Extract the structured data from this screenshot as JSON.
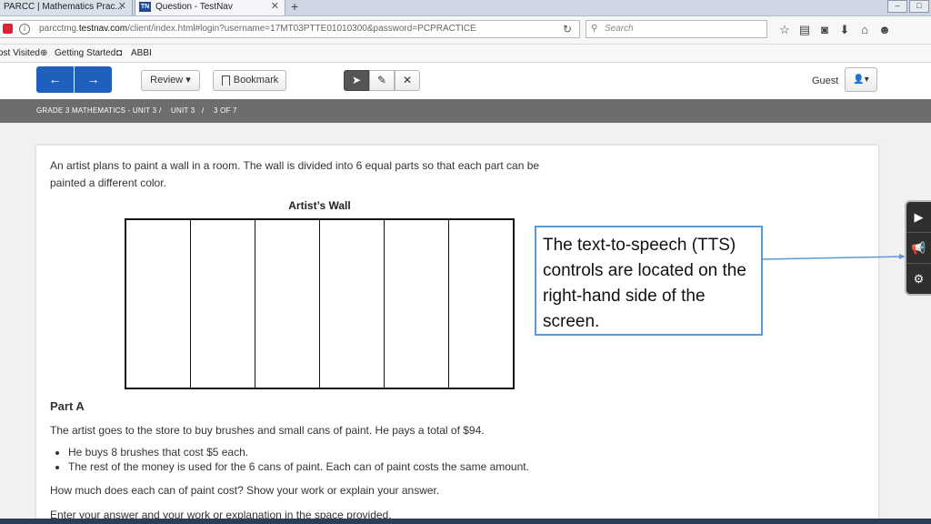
{
  "browser": {
    "tabs": [
      {
        "label": "PARCC | Mathematics Prac...",
        "close": "✕"
      },
      {
        "label": "Question - TestNav",
        "close": "✕",
        "favicon": "TN"
      }
    ],
    "new_tab": "+",
    "url": {
      "prefix": "parcctmg.",
      "domain": "testnav.com",
      "path": "/client/index.html#login?username=17MT03PTTE01010300&password=PCPRACTICE"
    },
    "search_placeholder": "Search",
    "bookmarks": [
      "ost Visited",
      "Getting Started",
      "ABBI"
    ]
  },
  "toolbar": {
    "back_icon": "←",
    "forward_icon": "→",
    "review_label": "Review ▾",
    "bookmark_label": "Bookmark",
    "pointer_icon": "➤",
    "pencil_icon": "✎",
    "eliminate_icon": "✕",
    "user_label": "Guest",
    "user_icon": "👤▾"
  },
  "breadcrumb": {
    "course": "GRADE 3 MATHEMATICS - UNIT 3",
    "sep": "/",
    "unit": "UNIT 3",
    "position": "3 OF 7"
  },
  "question": {
    "intro_line1": "An artist plans to paint a wall in a room. The wall is divided into 6 equal parts so that each part can be",
    "intro_line2": "painted a different color.",
    "figure_title": "Artist’s Wall",
    "figure_parts": 6,
    "part_label": "Part A",
    "stem": "The artist goes to the store to buy brushes and small cans of paint. He pays a total of $94.",
    "bullets": [
      "He buys 8 brushes that cost $5 each.",
      "The rest of the money is used for the 6 cans of paint. Each can of paint costs the same amount."
    ],
    "prompt": "How much does each can of paint cost? Show your work or explain your answer.",
    "instruction": "Enter your answer and your work or explanation in the space provided."
  },
  "callout": {
    "text": "The text-to-speech (TTS) controls are located on the right-hand side of the screen.",
    "border_color": "#5b9bd5"
  },
  "tts_panel": {
    "play_icon": "▶",
    "speaker_icon": "📢",
    "settings_icon": "⚙"
  }
}
